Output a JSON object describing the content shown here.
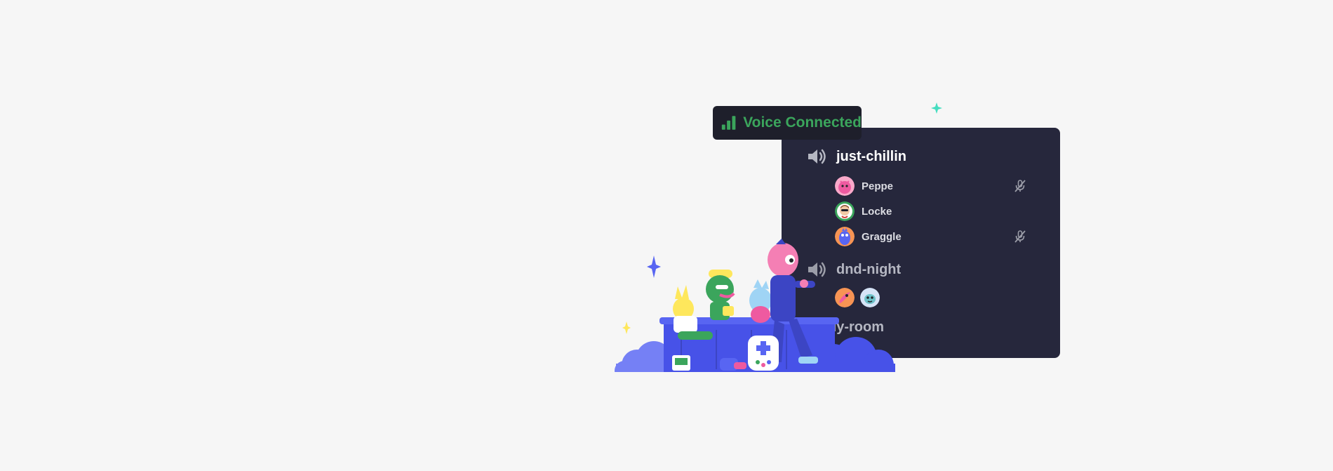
{
  "banner": {
    "text": "Voice Connected",
    "icon": "signal-bars-icon",
    "color": "#3ba55c"
  },
  "panel": {
    "background": "#26273c"
  },
  "channels": [
    {
      "name": "just-chillin",
      "icon": "speaker-icon",
      "active": true,
      "members": [
        {
          "name": "Peppe",
          "avatar": "pink-monster-avatar",
          "muted": true
        },
        {
          "name": "Locke",
          "avatar": "green-ring-avatar",
          "muted": false
        },
        {
          "name": "Graggle",
          "avatar": "blue-creature-avatar",
          "muted": true
        }
      ]
    },
    {
      "name": "dnd-night",
      "icon": "speaker-icon",
      "active": false,
      "avatars": [
        "orange-avatar",
        "light-blue-avatar"
      ]
    },
    {
      "name": "study-room",
      "active": false
    }
  ],
  "illustration": {
    "name": "friends-hanging-out-illustration",
    "accent_colors": [
      "#5865f2",
      "#3ba55c",
      "#f47fb4",
      "#fee75c"
    ]
  }
}
